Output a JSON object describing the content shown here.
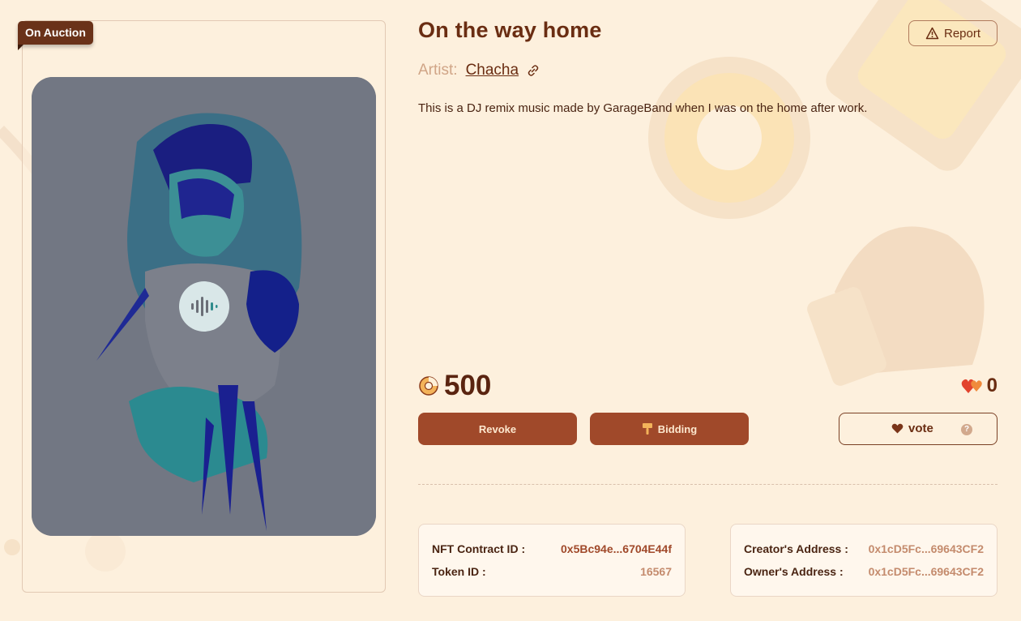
{
  "status_ribbon": "On Auction",
  "nft": {
    "title": "On the way home",
    "artist_label": "Artist:",
    "artist_name": "Chacha",
    "description": "This is a DJ remix music made by GarageBand when I was on the home after work."
  },
  "report_label": "Report",
  "price": "500",
  "likes_count": "0",
  "actions": {
    "revoke_label": "Revoke",
    "bidding_label": "Bidding",
    "vote_label": "vote",
    "vote_help": "?"
  },
  "contract_info": {
    "contract_label": "NFT Contract ID :",
    "contract_value": "0x5Bc94e...6704E44f",
    "token_label": "Token ID :",
    "token_value": "16567"
  },
  "address_info": {
    "creator_label": "Creator's Address :",
    "creator_value": "0x1cD5Fc...69643CF2",
    "owner_label": "Owner's Address :",
    "owner_value": "0x1cD5Fc...69643CF2"
  },
  "colors": {
    "background": "#fdf0dd",
    "primary_button": "#a0492a",
    "text_dark": "#6a2d12",
    "accent": "#a0492a"
  },
  "icons": [
    "warning-icon",
    "link-icon",
    "donut-coin-icon",
    "hearts-icon",
    "hammer-icon",
    "heart-icon",
    "help-icon",
    "audio-wave-icon"
  ]
}
